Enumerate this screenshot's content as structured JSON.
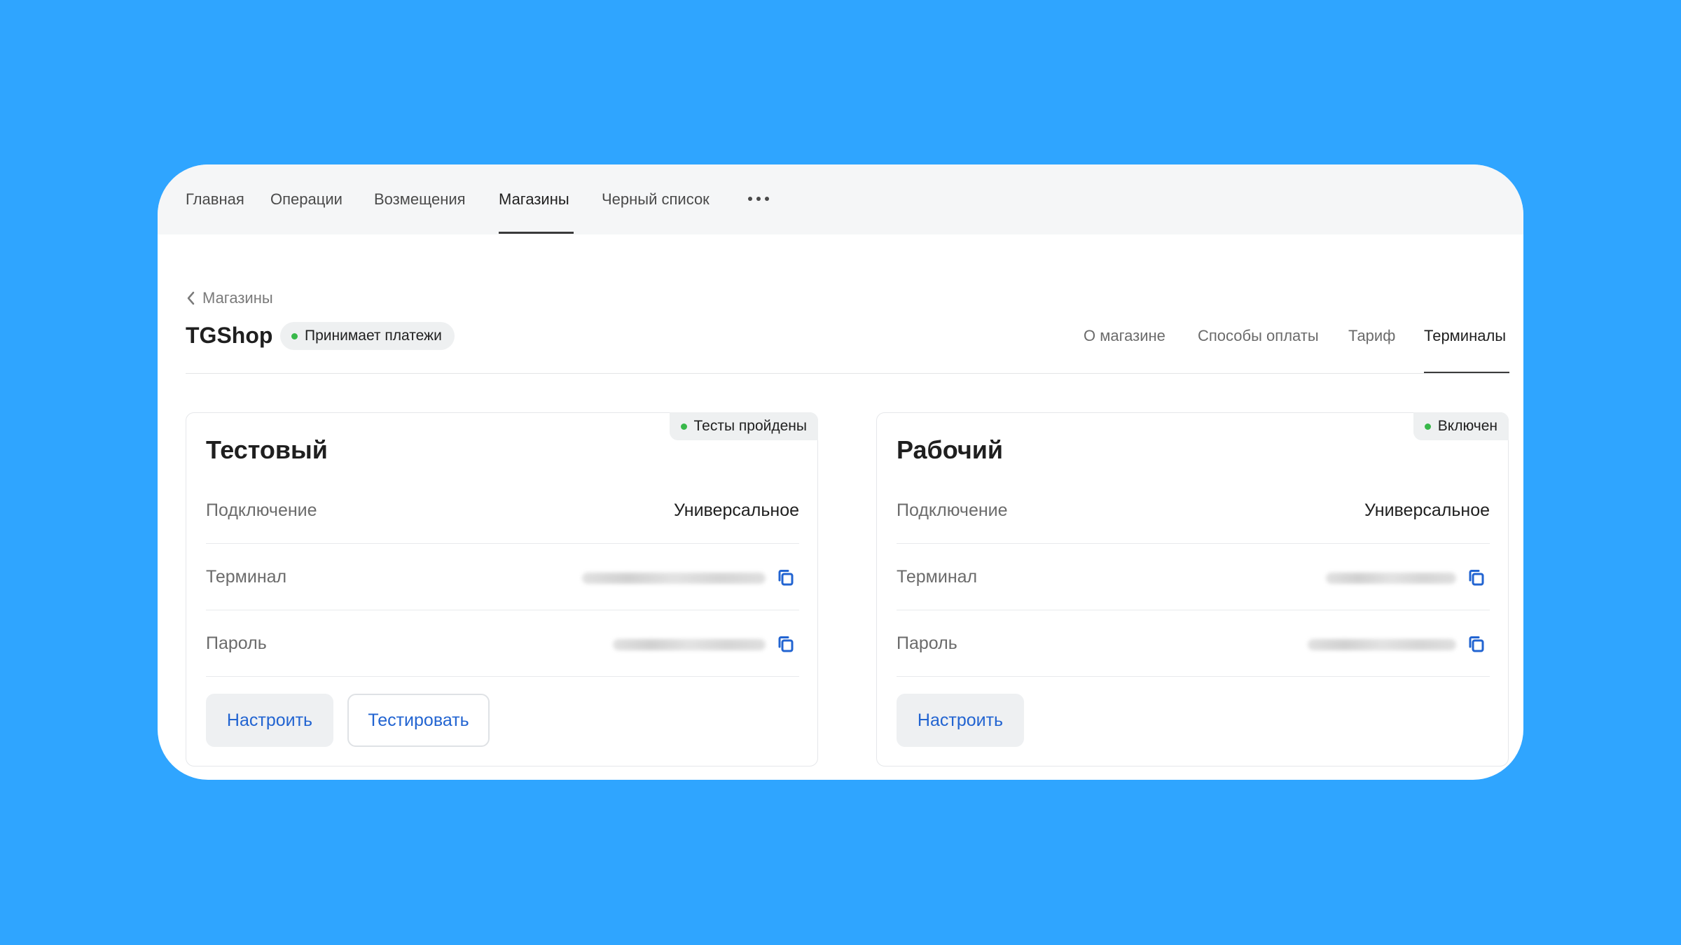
{
  "nav": {
    "items": [
      {
        "label": "Главная"
      },
      {
        "label": "Операции"
      },
      {
        "label": "Возмещения"
      },
      {
        "label": "Магазины"
      },
      {
        "label": "Черный список"
      }
    ],
    "active": "Магазины",
    "more_icon": "more-horizontal-icon"
  },
  "breadcrumb": {
    "label": "Магазины",
    "icon": "chevron-left-icon"
  },
  "shop": {
    "name": "TGShop",
    "status": "Принимает платежи",
    "status_color": "#38b84a"
  },
  "tabs": {
    "items": [
      {
        "label": "О магазине"
      },
      {
        "label": "Способы оплаты"
      },
      {
        "label": "Тариф"
      },
      {
        "label": "Терминалы"
      }
    ],
    "active": "Терминалы"
  },
  "cards": [
    {
      "title": "Тестовый",
      "badge": "Тесты пройдены",
      "rows": [
        {
          "label": "Подключение",
          "value": "Универсальное"
        },
        {
          "label": "Терминал"
        },
        {
          "label": "Пароль"
        }
      ],
      "buttons": [
        {
          "label": "Настроить"
        },
        {
          "label": "Тестировать"
        }
      ]
    },
    {
      "title": "Рабочий",
      "badge": "Включен",
      "rows": [
        {
          "label": "Подключение",
          "value": "Универсальное"
        },
        {
          "label": "Терминал"
        },
        {
          "label": "Пароль"
        }
      ],
      "buttons": [
        {
          "label": "Настроить"
        }
      ]
    }
  ],
  "colors": {
    "background": "#2fa5ff",
    "accent": "#2264d1",
    "status_green": "#38b84a"
  }
}
